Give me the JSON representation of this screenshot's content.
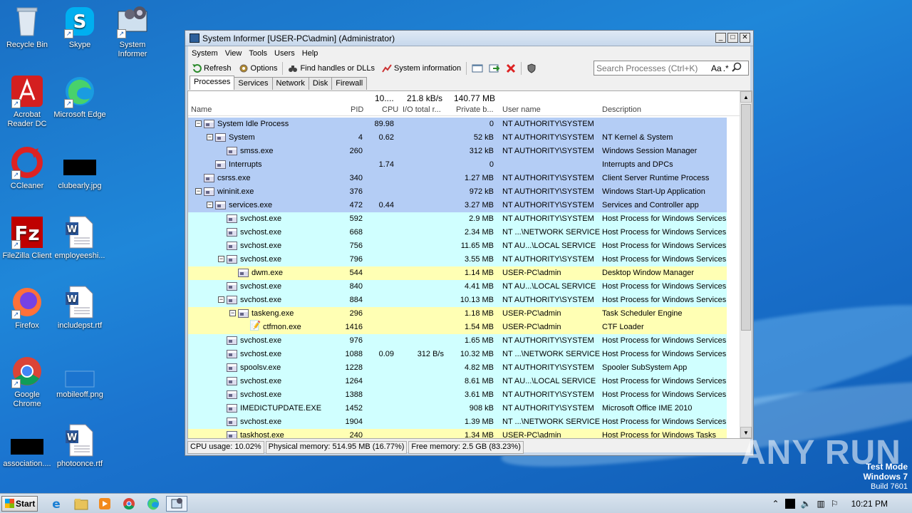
{
  "desktop": {
    "icons": [
      {
        "label": "Recycle Bin"
      },
      {
        "label": "Skype"
      },
      {
        "label": "System Informer"
      },
      {
        "label": "Acrobat Reader DC"
      },
      {
        "label": "Microsoft Edge"
      },
      {
        "label": "CCleaner"
      },
      {
        "label": "clubearly.jpg"
      },
      {
        "label": "FileZilla Client"
      },
      {
        "label": "employeeshi..."
      },
      {
        "label": "Firefox"
      },
      {
        "label": "includepst.rtf"
      },
      {
        "label": "Google Chrome"
      },
      {
        "label": "mobileoff.png"
      },
      {
        "label": "association...."
      },
      {
        "label": "photoonce.rtf"
      }
    ]
  },
  "window": {
    "title": "System Informer [USER-PC\\admin] (Administrator)",
    "menu": [
      "System",
      "View",
      "Tools",
      "Users",
      "Help"
    ],
    "toolbar": {
      "refresh": "Refresh",
      "options": "Options",
      "find": "Find handles or DLLs",
      "sysinfo": "System information"
    },
    "search_placeholder": "Search Processes (Ctrl+K)",
    "search_aa": "Aa",
    "search_regex": ".*",
    "tabs": [
      "Processes",
      "Services",
      "Network",
      "Disk",
      "Firewall"
    ],
    "totals": {
      "cpu": "10....",
      "io": "21.8 kB/s",
      "private": "140.77 MB"
    },
    "columns": {
      "name": "Name",
      "pid": "PID",
      "cpu": "CPU",
      "io": "I/O total r...",
      "private": "Private b...",
      "user": "User name",
      "desc": "Description"
    },
    "processes": [
      {
        "name": "System Idle Process",
        "pid": "",
        "cpu": "89.98",
        "io": "",
        "private": "0",
        "user": "NT AUTHORITY\\SYSTEM",
        "desc": "",
        "depth": 0,
        "exp": "-",
        "color": "#b4cdf5"
      },
      {
        "name": "System",
        "pid": "4",
        "cpu": "0.62",
        "io": "",
        "private": "52 kB",
        "user": "NT AUTHORITY\\SYSTEM",
        "desc": "NT Kernel & System",
        "depth": 1,
        "exp": "-",
        "color": "#b4cdf5"
      },
      {
        "name": "smss.exe",
        "pid": "260",
        "cpu": "",
        "io": "",
        "private": "312 kB",
        "user": "NT AUTHORITY\\SYSTEM",
        "desc": "Windows Session Manager",
        "depth": 2,
        "exp": "",
        "color": "#b4cdf5"
      },
      {
        "name": "Interrupts",
        "pid": "",
        "cpu": "1.74",
        "io": "",
        "private": "0",
        "user": "",
        "desc": "Interrupts and DPCs",
        "depth": 1,
        "exp": "",
        "color": "#b4cdf5"
      },
      {
        "name": "csrss.exe",
        "pid": "340",
        "cpu": "",
        "io": "",
        "private": "1.27 MB",
        "user": "NT AUTHORITY\\SYSTEM",
        "desc": "Client Server Runtime Process",
        "depth": 0,
        "exp": "",
        "color": "#b4cdf5"
      },
      {
        "name": "wininit.exe",
        "pid": "376",
        "cpu": "",
        "io": "",
        "private": "972 kB",
        "user": "NT AUTHORITY\\SYSTEM",
        "desc": "Windows Start-Up Application",
        "depth": 0,
        "exp": "-",
        "color": "#b4cdf5"
      },
      {
        "name": "services.exe",
        "pid": "472",
        "cpu": "0.44",
        "io": "",
        "private": "3.27 MB",
        "user": "NT AUTHORITY\\SYSTEM",
        "desc": "Services and Controller app",
        "depth": 1,
        "exp": "-",
        "color": "#b4cdf5"
      },
      {
        "name": "svchost.exe",
        "pid": "592",
        "cpu": "",
        "io": "",
        "private": "2.9 MB",
        "user": "NT AUTHORITY\\SYSTEM",
        "desc": "Host Process for Windows Services",
        "depth": 2,
        "exp": "",
        "color": "#d0ffff"
      },
      {
        "name": "svchost.exe",
        "pid": "668",
        "cpu": "",
        "io": "",
        "private": "2.34 MB",
        "user": "NT ...\\NETWORK SERVICE",
        "desc": "Host Process for Windows Services",
        "depth": 2,
        "exp": "",
        "color": "#d0ffff"
      },
      {
        "name": "svchost.exe",
        "pid": "756",
        "cpu": "",
        "io": "",
        "private": "11.65 MB",
        "user": "NT AU...\\LOCAL SERVICE",
        "desc": "Host Process for Windows Services",
        "depth": 2,
        "exp": "",
        "color": "#d0ffff"
      },
      {
        "name": "svchost.exe",
        "pid": "796",
        "cpu": "",
        "io": "",
        "private": "3.55 MB",
        "user": "NT AUTHORITY\\SYSTEM",
        "desc": "Host Process for Windows Services",
        "depth": 2,
        "exp": "-",
        "color": "#d0ffff"
      },
      {
        "name": "dwm.exe",
        "pid": "544",
        "cpu": "",
        "io": "",
        "private": "1.14 MB",
        "user": "USER-PC\\admin",
        "desc": "Desktop Window Manager",
        "depth": 3,
        "exp": "",
        "color": "#ffffb4"
      },
      {
        "name": "svchost.exe",
        "pid": "840",
        "cpu": "",
        "io": "",
        "private": "4.41 MB",
        "user": "NT AU...\\LOCAL SERVICE",
        "desc": "Host Process for Windows Services",
        "depth": 2,
        "exp": "",
        "color": "#d0ffff"
      },
      {
        "name": "svchost.exe",
        "pid": "884",
        "cpu": "",
        "io": "",
        "private": "10.13 MB",
        "user": "NT AUTHORITY\\SYSTEM",
        "desc": "Host Process for Windows Services",
        "depth": 2,
        "exp": "-",
        "color": "#d0ffff"
      },
      {
        "name": "taskeng.exe",
        "pid": "296",
        "cpu": "",
        "io": "",
        "private": "1.18 MB",
        "user": "USER-PC\\admin",
        "desc": "Task Scheduler Engine",
        "depth": 3,
        "exp": "-",
        "color": "#ffffb4"
      },
      {
        "name": "ctfmon.exe",
        "pid": "1416",
        "cpu": "",
        "io": "",
        "private": "1.54 MB",
        "user": "USER-PC\\admin",
        "desc": "CTF Loader",
        "depth": 4,
        "exp": "",
        "color": "#ffffb4",
        "icon": "pen"
      },
      {
        "name": "svchost.exe",
        "pid": "976",
        "cpu": "",
        "io": "",
        "private": "1.65 MB",
        "user": "NT AUTHORITY\\SYSTEM",
        "desc": "Host Process for Windows Services",
        "depth": 2,
        "exp": "",
        "color": "#d0ffff"
      },
      {
        "name": "svchost.exe",
        "pid": "1088",
        "cpu": "0.09",
        "io": "312 B/s",
        "private": "10.32 MB",
        "user": "NT ...\\NETWORK SERVICE",
        "desc": "Host Process for Windows Services",
        "depth": 2,
        "exp": "",
        "color": "#d0ffff"
      },
      {
        "name": "spoolsv.exe",
        "pid": "1228",
        "cpu": "",
        "io": "",
        "private": "4.82 MB",
        "user": "NT AUTHORITY\\SYSTEM",
        "desc": "Spooler SubSystem App",
        "depth": 2,
        "exp": "",
        "color": "#d0ffff"
      },
      {
        "name": "svchost.exe",
        "pid": "1264",
        "cpu": "",
        "io": "",
        "private": "8.61 MB",
        "user": "NT AU...\\LOCAL SERVICE",
        "desc": "Host Process for Windows Services",
        "depth": 2,
        "exp": "",
        "color": "#d0ffff"
      },
      {
        "name": "svchost.exe",
        "pid": "1388",
        "cpu": "",
        "io": "",
        "private": "3.61 MB",
        "user": "NT AUTHORITY\\SYSTEM",
        "desc": "Host Process for Windows Services",
        "depth": 2,
        "exp": "",
        "color": "#d0ffff"
      },
      {
        "name": "IMEDICTUPDATE.EXE",
        "pid": "1452",
        "cpu": "",
        "io": "",
        "private": "908 kB",
        "user": "NT AUTHORITY\\SYSTEM",
        "desc": "Microsoft Office IME 2010",
        "depth": 2,
        "exp": "",
        "color": "#d0ffff"
      },
      {
        "name": "svchost.exe",
        "pid": "1904",
        "cpu": "",
        "io": "",
        "private": "1.39 MB",
        "user": "NT ...\\NETWORK SERVICE",
        "desc": "Host Process for Windows Services",
        "depth": 2,
        "exp": "",
        "color": "#d0ffff"
      },
      {
        "name": "taskhost.exe",
        "pid": "240",
        "cpu": "",
        "io": "",
        "private": "1.34 MB",
        "user": "USER-PC\\admin",
        "desc": "Host Process for Windows Tasks",
        "depth": 2,
        "exp": "",
        "color": "#ffffb4"
      }
    ],
    "status": {
      "cpu": "CPU usage: 10.02%",
      "physical": "Physical memory: 514.95 MB (16.77%)",
      "free": "Free memory: 2.5 GB (83.23%)"
    }
  },
  "taskbar": {
    "start": "Start",
    "clock": "10:21 PM"
  },
  "watermark": "ANY RUN",
  "test_mode": {
    "line1": "Test Mode",
    "line2": "Windows 7",
    "line3": "Build 7601"
  }
}
